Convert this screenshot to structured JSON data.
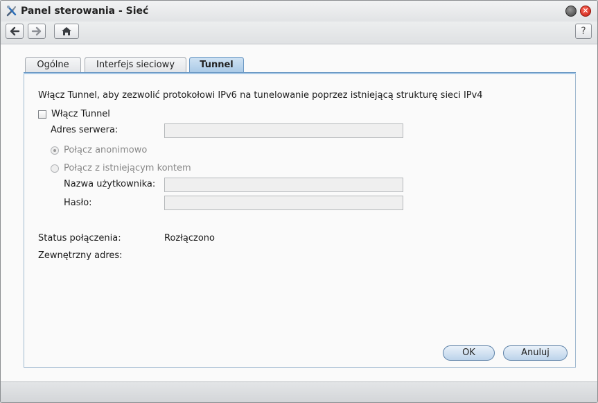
{
  "window": {
    "title": "Panel sterowania - Sieć",
    "icons": {
      "app": "control-panel-wrench-icon",
      "minimize": "minimize-icon",
      "close": "close-icon"
    },
    "help_label": "?"
  },
  "toolbar": {
    "back_icon": "arrow-left-icon",
    "forward_icon": "arrow-right-icon",
    "home_icon": "home-icon",
    "help_icon": "help-icon"
  },
  "tabs": [
    {
      "label": "Ogólne",
      "active": false
    },
    {
      "label": "Interfejs sieciowy",
      "active": false
    },
    {
      "label": "Tunnel",
      "active": true
    }
  ],
  "tunnel": {
    "description": "Włącz Tunnel, aby zezwolić protokołowi IPv6 na tunelowanie poprzez istniejącą strukturę sieci IPv4",
    "enable_label": "Włącz Tunnel",
    "enable_checked": false,
    "server_label": "Adres serwera:",
    "server_value": "",
    "radio_anonymous_label": "Połącz anonimowo",
    "radio_anonymous_selected": true,
    "radio_account_label": "Połącz z istniejącym kontem",
    "radio_account_selected": false,
    "username_label": "Nazwa użytkownika:",
    "username_value": "",
    "password_label": "Hasło:",
    "password_value": "",
    "status_label": "Status połączenia:",
    "status_value": "Rozłączono",
    "external_label": "Zewnętrzny adres:",
    "external_value": ""
  },
  "buttons": {
    "ok": "OK",
    "cancel": "Anuluj"
  },
  "colors": {
    "active_tab": "#a9c9e6",
    "button_border": "#5a7fa6",
    "close": "#c21a10"
  }
}
